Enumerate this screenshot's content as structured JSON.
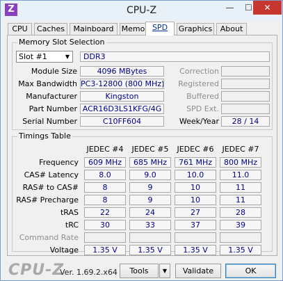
{
  "window": {
    "title": "CPU-Z",
    "app_icon_glyph": "Z",
    "minimize_glyph": "—",
    "maximize_glyph": "☐",
    "close_glyph": "✕"
  },
  "tabs": [
    "CPU",
    "Caches",
    "Mainboard",
    "Memory",
    "SPD",
    "Graphics",
    "About"
  ],
  "active_tab": "SPD",
  "slot_group": {
    "legend": "Memory Slot Selection",
    "slot_selected": "Slot #1",
    "memory_type": "DDR3",
    "labels": {
      "module_size": "Module Size",
      "max_bandwidth": "Max Bandwidth",
      "manufacturer": "Manufacturer",
      "part_number": "Part Number",
      "serial_number": "Serial Number",
      "correction": "Correction",
      "registered": "Registered",
      "buffered": "Buffered",
      "spd_ext": "SPD Ext.",
      "week_year": "Week/Year"
    },
    "values": {
      "module_size": "4096 MBytes",
      "max_bandwidth": "PC3-12800 (800 MHz)",
      "manufacturer": "Kingston",
      "part_number": "ACR16D3LS1KFG/4G",
      "serial_number": "C10FF604",
      "correction": "",
      "registered": "",
      "buffered": "",
      "spd_ext": "",
      "week_year": "28 / 14"
    }
  },
  "timings": {
    "legend": "Timings Table",
    "columns": [
      "JEDEC #4",
      "JEDEC #5",
      "JEDEC #6",
      "JEDEC #7"
    ],
    "rows": [
      {
        "label": "Frequency",
        "dim": false,
        "values": [
          "609 MHz",
          "685 MHz",
          "761 MHz",
          "800 MHz"
        ]
      },
      {
        "label": "CAS# Latency",
        "dim": false,
        "values": [
          "8.0",
          "9.0",
          "10.0",
          "11.0"
        ]
      },
      {
        "label": "RAS# to CAS#",
        "dim": false,
        "values": [
          "8",
          "9",
          "10",
          "11"
        ]
      },
      {
        "label": "RAS# Precharge",
        "dim": false,
        "values": [
          "8",
          "9",
          "10",
          "11"
        ]
      },
      {
        "label": "tRAS",
        "dim": false,
        "values": [
          "22",
          "24",
          "27",
          "28"
        ]
      },
      {
        "label": "tRC",
        "dim": false,
        "values": [
          "30",
          "33",
          "37",
          "39"
        ]
      },
      {
        "label": "Command Rate",
        "dim": true,
        "values": [
          "",
          "",
          "",
          ""
        ]
      },
      {
        "label": "Voltage",
        "dim": false,
        "values": [
          "1.35 V",
          "1.35 V",
          "1.35 V",
          "1.35 V"
        ]
      }
    ]
  },
  "footer": {
    "brand": "CPU-Z",
    "version": "Ver. 1.69.2.x64",
    "tools_label": "Tools",
    "validate_label": "Validate",
    "ok_label": "OK"
  }
}
